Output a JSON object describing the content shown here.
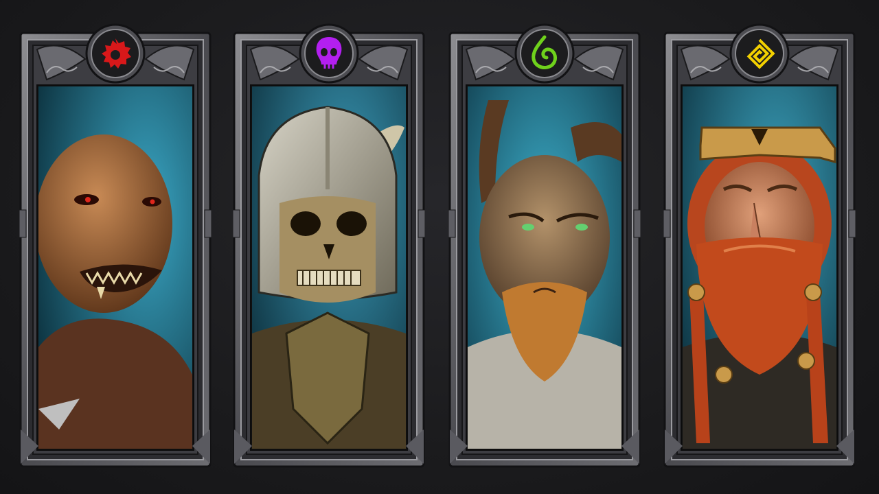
{
  "screen": {
    "title": "",
    "background_color": "#1b1b1d"
  },
  "races": [
    {
      "emblem_icon": "horde-cog-icon",
      "emblem_color": "#d8181a",
      "portrait_subject": "orc",
      "portrait_bg": "#1f6f8a"
    },
    {
      "emblem_icon": "skull-icon",
      "emblem_color": "#b31ff0",
      "portrait_subject": "undead-skeleton-helmet",
      "portrait_bg": "#1d5f78"
    },
    {
      "emblem_icon": "leaf-spiral-icon",
      "emblem_color": "#6fd11c",
      "portrait_subject": "horned-beast",
      "portrait_bg": "#1e6e86"
    },
    {
      "emblem_icon": "square-spiral-icon",
      "emblem_color": "#f2d000",
      "portrait_subject": "dwarf",
      "portrait_bg": "#1e6a82"
    }
  ]
}
